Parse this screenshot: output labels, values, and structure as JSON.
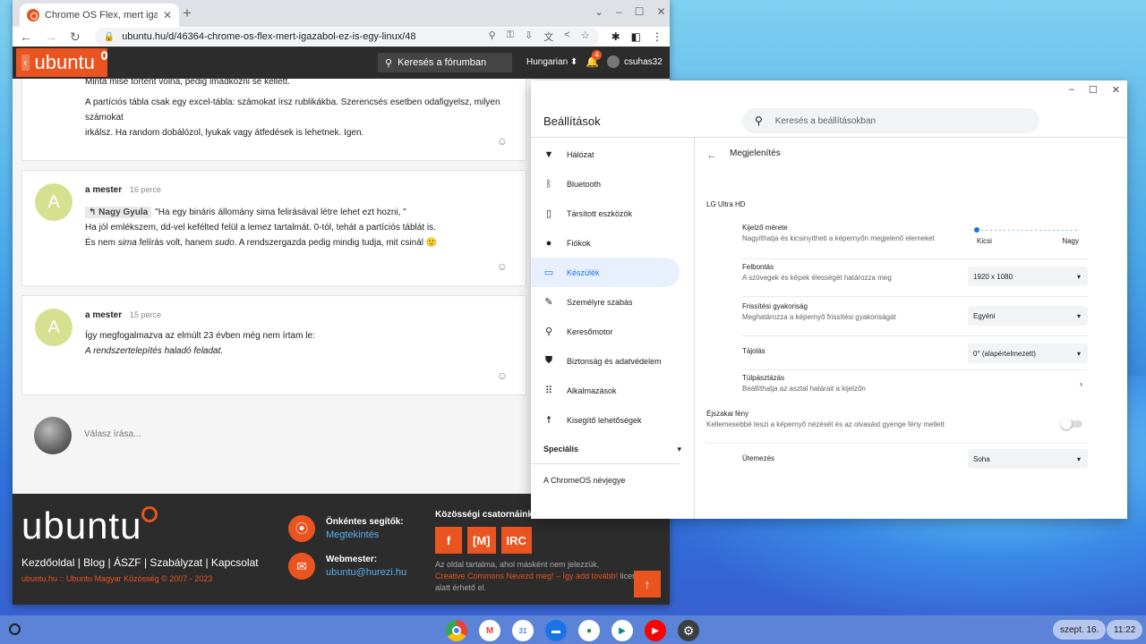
{
  "browser": {
    "tab_title": "Chrome OS Flex, mert igazából ezt",
    "url": "ubuntu.hu/d/46364-chrome-os-flex-mert-igazabol-ez-is-egy-linux/48"
  },
  "site": {
    "logo_text": "ubuntu",
    "search_placeholder": "Keresés a fórumban",
    "language": "Hungarian",
    "notif_count": "4",
    "username": "csuhas32"
  },
  "posts": [
    {
      "id": "p0",
      "lines": [
        "Minta mise történt volna, pedig imádkozni se kellett.",
        "A partíciós tábla csak egy excel-tábla: számokat írsz rublikákba. Szerencsés esetben odafigyelsz, milyen számokat",
        "irkálsz. Ha random dobálózol, lyukak vagy átfedések is lehetnek. Igen."
      ]
    },
    {
      "id": "p1",
      "avatar": "A",
      "author": "a mester",
      "time": "16 perce",
      "quote_name": "Nagy Gyula",
      "quote_text": "\"Ha egy bináris állomány sima felirásával létre lehet ezt hozni, \"",
      "line2": "Ha jól emlékszem, dd-vel kefélted felül a lemez tartalmát. 0-tól, tehát a partíciós táblát is.",
      "line3_a": "És nem ",
      "line3_em1": "sima",
      "line3_b": " felírás volt, hanem ",
      "line3_em2": "sudo",
      "line3_c": ". A rendszergazda pedig mindig tudja, mit csinál 🙂"
    },
    {
      "id": "p2",
      "avatar": "A",
      "author": "a mester",
      "time": "15 perce",
      "line1": "Így megfogalmazva az elmúlt 23 évben még nem írtam le:",
      "line2": "A rendszertelepítés haladó feladat."
    }
  ],
  "reply_placeholder": "Válasz írása...",
  "footer": {
    "logo": "ubuntu",
    "links": "Kezdőoldal | Blog | ÁSZF | Szabályzat | Kapcsolat",
    "copyright": "ubuntu.hu :: Ubuntu Magyar Közösség © 2007 - 2023",
    "helpers_title": "Önkéntes segítők:",
    "helpers_link": "Megtekintés",
    "webmaster_title": "Webmester:",
    "webmaster_email": "ubuntu@hurezi.hu",
    "community_title": "Közösségi csatornáink",
    "btn_f": "f",
    "btn_m": "[M]",
    "btn_irc": "IRC",
    "note1": "Az oldal tartalma, ahol másként nem jelezzük,",
    "note_link": "Creative Commons Nevezd meg! – Így add tovább!",
    "note2": " licenc",
    "note3": "alatt érhető el."
  },
  "settings": {
    "title": "Beállítások",
    "search_placeholder": "Keresés a beállításokban",
    "nav": [
      {
        "icon": "wifi-icon",
        "glyph": "▼",
        "label": "Hálózat"
      },
      {
        "icon": "bluetooth-icon",
        "glyph": "ᛒ",
        "label": "Bluetooth"
      },
      {
        "icon": "phone-icon",
        "glyph": "▯",
        "label": "Társított eszközök"
      },
      {
        "icon": "person-icon",
        "glyph": "●",
        "label": "Fiókok"
      },
      {
        "icon": "laptop-icon",
        "glyph": "▭",
        "label": "Készülék"
      },
      {
        "icon": "brush-icon",
        "glyph": "✎",
        "label": "Személyre szabás"
      },
      {
        "icon": "search-icon",
        "glyph": "⚲",
        "label": "Keresőmotor"
      },
      {
        "icon": "shield-icon",
        "glyph": "⛊",
        "label": "Biztonság és adatvédelem"
      },
      {
        "icon": "grid-icon",
        "glyph": "⠿",
        "label": "Alkalmazások"
      },
      {
        "icon": "accessibility-icon",
        "glyph": "☨",
        "label": "Kisegítő lehetőségek"
      }
    ],
    "special": "Speciális",
    "about": "A ChromeOS névjegye",
    "section_title": "Megjelenítés",
    "monitor": "LG Ultra HD",
    "display_size_label": "Kijelző mérete",
    "display_size_sub": "Nagyíthatja és kicsinyítheti a képernyőn megjelenő elemeket",
    "display_size_small": "Kicsi",
    "display_size_large": "Nagy",
    "resolution_label": "Felbontás",
    "resolution_sub": "A szövegek és képek élességét határozza meg",
    "resolution_value": "1920 x 1080",
    "refresh_label": "Frissítési gyakoriság",
    "refresh_sub": "Meghatározza a képernyő frissítési gyakoriságát",
    "refresh_value": "Egyéni",
    "orientation_label": "Tájolás",
    "orientation_value": "0° (alapértelmezett)",
    "overscan_label": "Túlpásztázás",
    "overscan_sub": "Beállíthatja az asztal határait a kijelzőn",
    "night_label": "Éjszakai fény",
    "night_sub": "Kellemesebbé teszi a képernyő nézését és az olvasást gyenge fény mellett",
    "schedule_label": "Ütemezés",
    "schedule_value": "Soha"
  },
  "shelf": {
    "date": "szept. 16.",
    "time": "11:22",
    "apps": [
      {
        "name": "chrome-icon",
        "color": "#db4437",
        "glyph": ""
      },
      {
        "name": "gmail-icon",
        "color": "#ea4335",
        "glyph": "M"
      },
      {
        "name": "calendar-icon",
        "color": "#4285f4",
        "glyph": "31"
      },
      {
        "name": "files-icon",
        "color": "#1a73e8",
        "glyph": "▬"
      },
      {
        "name": "chat-icon",
        "color": "#1e8e3e",
        "glyph": "●"
      },
      {
        "name": "meet-icon",
        "color": "#00897b",
        "glyph": "▶"
      },
      {
        "name": "youtube-icon",
        "color": "#ff0000",
        "glyph": "▶"
      },
      {
        "name": "settings-icon",
        "color": "#3c4043",
        "glyph": "⚙"
      }
    ]
  }
}
